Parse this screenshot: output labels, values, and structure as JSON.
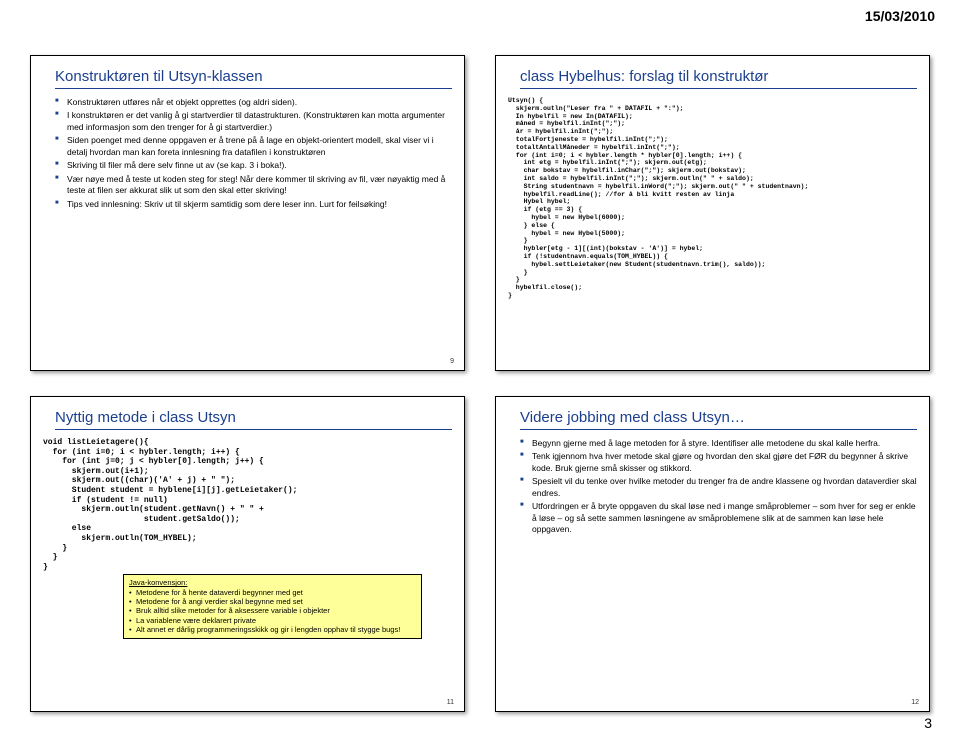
{
  "page": {
    "date": "15/03/2010",
    "pagenum": "3"
  },
  "slides": {
    "tl": {
      "num": "9",
      "title": "Konstruktøren til Utsyn-klassen",
      "bullets": [
        "Konstruktøren utføres når et objekt opprettes (og aldri siden).",
        "I konstruktøren er det vanlig å gi startverdier til datastrukturen. (Konstruktøren kan motta argumenter med informasjon som den trenger for å gi startverdier.)",
        "Siden poenget med denne oppgaven er å trene på å lage en objekt-orientert modell, skal viser vi i detalj hvordan man kan foreta innlesning fra datafilen i konstruktøren",
        "Skriving til filer må dere selv finne ut av (se kap. 3 i boka!).",
        "Vær nøye med å teste ut koden steg for steg! Når dere kommer til skriving av fil, vær nøyaktig med å teste at filen ser akkurat slik ut som den skal etter skriving!",
        "Tips ved innlesning: Skriv ut til skjerm samtidig som dere leser inn. Lurt for feilsøking!"
      ]
    },
    "tr": {
      "title": "class Hybelhus: forslag til konstruktør",
      "code": "Utsyn() {\n  skjerm.outln(\"Leser fra \" + DATAFIL + \":\");\n  In hybelfil = new In(DATAFIL);\n  måned = hybelfil.inInt(\";\");\n  år = hybelfil.inInt(\";\");\n  totalFortjeneste = hybelfil.inInt(\";\");\n  totaltAntallMåneder = hybelfil.inInt(\";\");\n  for (int i=0; i < hybler.length * hybler[0].length; i++) {\n    int etg = hybelfil.inInt(\";\"); skjerm.out(etg);\n    char bokstav = hybelfil.inChar(\";\"); skjerm.out(bokstav);\n    int saldo = hybelfil.inInt(\";\"); skjerm.outln(\" \" + saldo);\n    String studentnavn = hybelfil.inWord(\";\"); skjerm.out(\" \" + studentnavn);\n    hybelfil.readLine(); //for å bli kvitt resten av linja\n    Hybel hybel;\n    if (etg == 3) {\n      hybel = new Hybel(6000);\n    } else {\n      hybel = new Hybel(5000);\n    }\n    hybler[etg - 1][(int)(bokstav - 'A')] = hybel;\n    if (!studentnavn.equals(TOM_HYBEL)) {\n      hybel.settLeietaker(new Student(studentnavn.trim(), saldo));\n    }\n  }\n  hybelfil.close();\n}"
    },
    "bl": {
      "num": "11",
      "title": "Nyttig metode i class Utsyn",
      "code": "void listLeietagere(){\n  for (int i=0; i < hybler.length; i++) {\n    for (int j=0; j < hybler[0].length; j++) {\n      skjerm.out(i+1);\n      skjerm.out((char)('A' + j) + \" \");\n      Student student = hyblene[i][j].getLeietaker();\n      if (student != null)\n        skjerm.outln(student.getNavn() + \" \" +\n                     student.getSaldo());\n      else\n        skjerm.outln(TOM_HYBEL);\n    }\n  }\n}",
      "note": {
        "title": "Java-konvensjon:",
        "items": [
          "Metodene for å hente dataverdi begynner med get",
          "Metodene for å angi verdier skal begynne med set",
          "Bruk alltid slike metoder for å aksessere variable i objekter",
          "La variablene være deklarert private",
          "Alt annet er dårlig programmeringsskikk og gir i lengden opphav til stygge bugs!"
        ]
      }
    },
    "br": {
      "num": "12",
      "title": "Videre jobbing med class Utsyn…",
      "bullets": [
        "Begynn gjerne med å lage metoden for å styre. Identifiser alle metodene du skal kalle herfra.",
        "Tenk igjennom hva hver metode skal gjøre og hvordan den skal gjøre det FØR du begynner å skrive kode. Bruk gjerne små skisser og stikkord.",
        "Spesielt vil du tenke over hvilke metoder du trenger fra de andre klassene og hvordan dataverdier skal endres.",
        "Utfordringen er å bryte oppgaven du skal løse ned i mange småproblemer – som hver for seg er enkle å løse – og så sette sammen løsningene av småproblemene slik at de sammen kan løse hele oppgaven."
      ]
    }
  }
}
